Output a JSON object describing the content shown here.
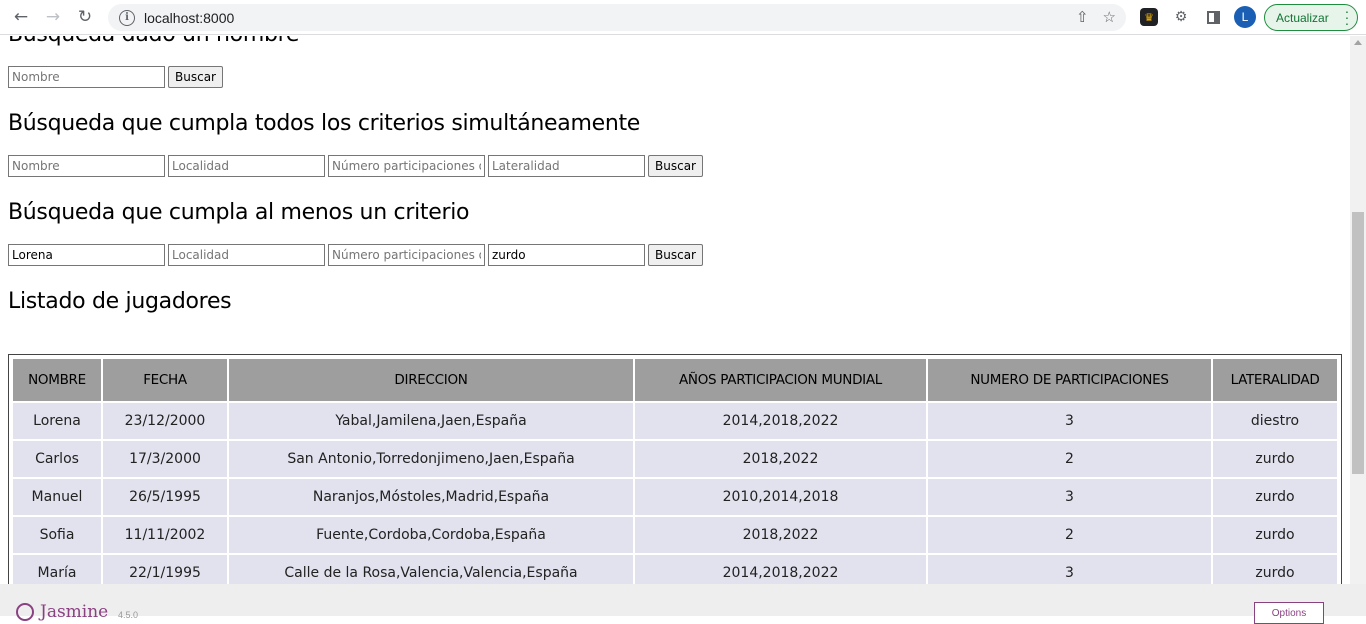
{
  "browser": {
    "url": "localhost:8000",
    "update_label": "Actualizar",
    "avatar_letter": "L"
  },
  "sections": {
    "by_name": {
      "title": "Búsqueda dado un nombre",
      "name_placeholder": "Nombre",
      "button": "Buscar"
    },
    "all_criteria": {
      "title": "Búsqueda que cumpla todos los criterios simultáneamente",
      "name_placeholder": "Nombre",
      "locality_placeholder": "Localidad",
      "participations_placeholder": "Número participaciones olímpicas",
      "laterality_placeholder": "Lateralidad",
      "button": "Buscar"
    },
    "any_criteria": {
      "title": "Búsqueda que cumpla al menos un criterio",
      "name_value": "Lorena",
      "locality_placeholder": "Localidad",
      "participations_placeholder": "Número participaciones olímpicas",
      "laterality_value": "zurdo",
      "button": "Buscar"
    },
    "list": {
      "title": "Listado de jugadores"
    }
  },
  "table": {
    "headers": [
      "NOMBRE",
      "FECHA",
      "DIRECCION",
      "AÑOS PARTICIPACION MUNDIAL",
      "NUMERO DE PARTICIPACIONES",
      "LATERALIDAD"
    ],
    "rows": [
      [
        "Lorena",
        "23/12/2000",
        "Yabal,Jamilena,Jaen,España",
        "2014,2018,2022",
        "3",
        "diestro"
      ],
      [
        "Carlos",
        "17/3/2000",
        "San Antonio,Torredonjimeno,Jaen,España",
        "2018,2022",
        "2",
        "zurdo"
      ],
      [
        "Manuel",
        "26/5/1995",
        "Naranjos,Móstoles,Madrid,España",
        "2010,2014,2018",
        "3",
        "zurdo"
      ],
      [
        "Sofia",
        "11/11/2002",
        "Fuente,Cordoba,Cordoba,España",
        "2018,2022",
        "2",
        "zurdo"
      ],
      [
        "María",
        "22/1/1995",
        "Calle de la Rosa,Valencia,Valencia,España",
        "2014,2018,2022",
        "3",
        "zurdo"
      ]
    ]
  },
  "jasmine": {
    "name": "Jasmine",
    "version": "4.5.0",
    "options_label": "Options"
  }
}
